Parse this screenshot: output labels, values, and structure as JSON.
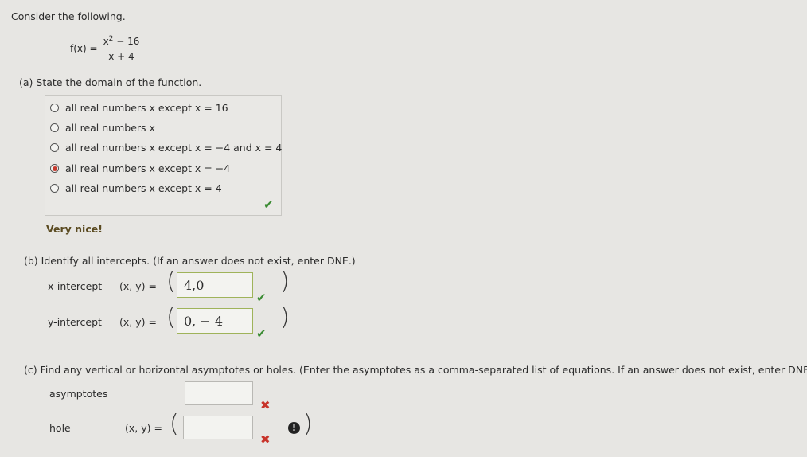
{
  "intro": "Consider the following.",
  "function": {
    "lhs": "f(x) =",
    "numerator": "x",
    "num_exp": "2",
    "num_rest": " − 16",
    "denominator": "x + 4"
  },
  "part_a": {
    "prompt": "(a)   State the domain of the function.",
    "choices": [
      {
        "label": "all real numbers x except x = 16",
        "selected": false
      },
      {
        "label": "all real numbers x",
        "selected": false
      },
      {
        "label": "all real numbers x except x = −4 and x = 4",
        "selected": false
      },
      {
        "label": "all real numbers x except x = −4",
        "selected": true
      },
      {
        "label": "all real numbers x except x = 4",
        "selected": false
      }
    ],
    "feedback": "Very nice!"
  },
  "part_b": {
    "prompt": "(b)   Identify all intercepts. (If an answer does not exist, enter DNE.)",
    "x_intercept": {
      "label": "x-intercept",
      "pair": "(x, y) =",
      "value": "4,0"
    },
    "y_intercept": {
      "label": "y-intercept",
      "pair": "(x, y) =",
      "value": "0, − 4"
    }
  },
  "part_c": {
    "prompt": "(c)   Find any vertical or horizontal asymptotes or holes. (Enter the asymptotes as a comma-separated list of equations. If an answer does not exist, enter DNE.)",
    "asymptotes_label": "asymptotes",
    "asymptotes_value": "",
    "hole_label": "hole",
    "hole_pair": "(x, y) =",
    "hole_value": ""
  },
  "colors": {
    "correct": "#3a8b32",
    "incorrect": "#c8342b",
    "selected_radio": "#c53a2e"
  }
}
